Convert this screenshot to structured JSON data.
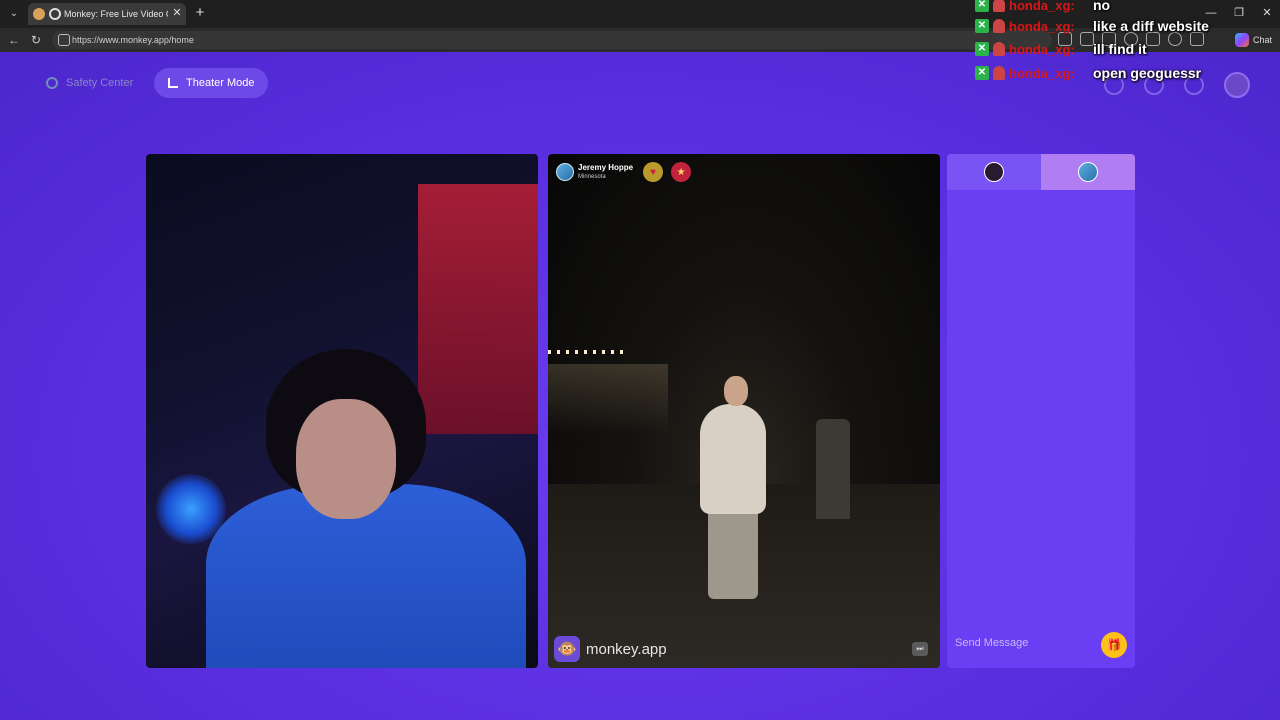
{
  "browser": {
    "tab_title": "Monkey: Free Live Video Chat",
    "tab_close": "✕",
    "new_tab": "+",
    "url": "https://www.monkey.app/home",
    "chat_label": "Chat",
    "window_controls": [
      "—",
      "❐",
      "✕"
    ]
  },
  "header": {
    "safety_center": "Safety Center",
    "theater_mode": "Theater Mode"
  },
  "overlay_chat": [
    {
      "user": "honda_xg:",
      "message": "no"
    },
    {
      "user": "honda_xg:",
      "message": "like a diff website"
    },
    {
      "user": "honda_xg:",
      "message": "ill find it"
    },
    {
      "user": "honda_xg:",
      "message": "open geoguessr"
    }
  ],
  "partner": {
    "name": "Jeremy Hoppe",
    "location": "Minnesota",
    "badges": [
      "heart-icon",
      "gift-icon"
    ]
  },
  "brand": {
    "logo_icon": "monkey-icon",
    "text": "monkey.app"
  },
  "chat": {
    "placeholder": "Send Message",
    "gift_icon": "gift-icon"
  },
  "colors": {
    "page_background": "#5a2fe0",
    "chat_panel": "#6a3ef2",
    "gift_button": "#ffc01a",
    "overlay_username": "#d81818"
  }
}
